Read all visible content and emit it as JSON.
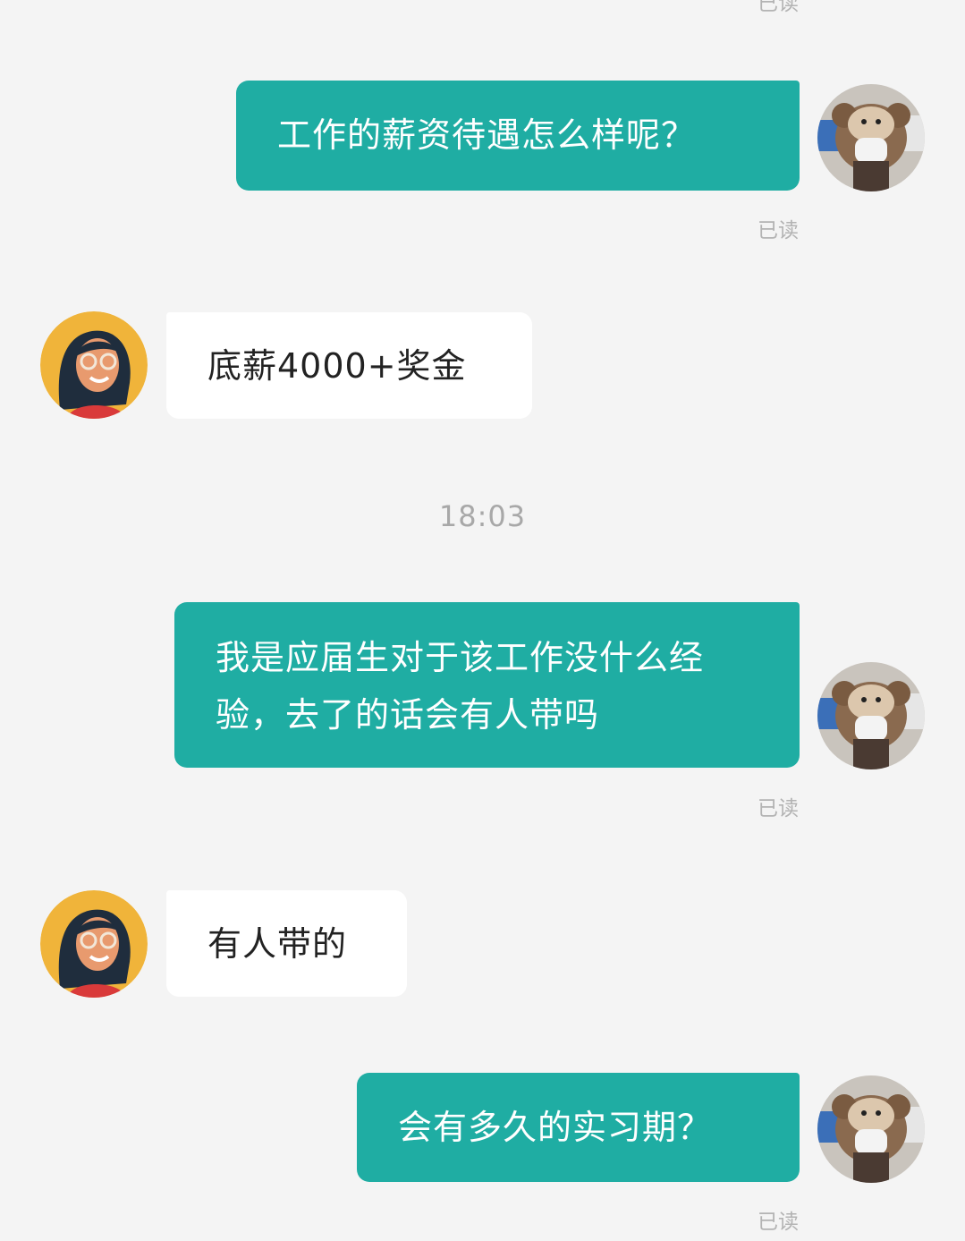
{
  "chat": {
    "messages": [
      {
        "side": "right",
        "text": "工作的薪资待遇怎么样呢？",
        "status": "已读"
      },
      {
        "side": "left",
        "text": "底薪4000+奖金"
      },
      {
        "side": "right",
        "text": "我是应届生对于该工作没什么经验，去了的话会有人带吗",
        "status": "已读"
      },
      {
        "side": "left",
        "text": "有人带的"
      },
      {
        "side": "right",
        "text": "会有多久的实习期？",
        "status": "已读"
      }
    ],
    "timestamp": "18:03",
    "top_partial_status": "已读"
  },
  "icons": {
    "self_avatar": "user-avatar-icon",
    "recruiter_avatar": "recruiter-avatar-icon"
  },
  "colors": {
    "background": "#f4f4f4",
    "outgoing_bubble": "#1fada3",
    "incoming_bubble": "#ffffff",
    "read_receipt": "#b3b3b3"
  }
}
